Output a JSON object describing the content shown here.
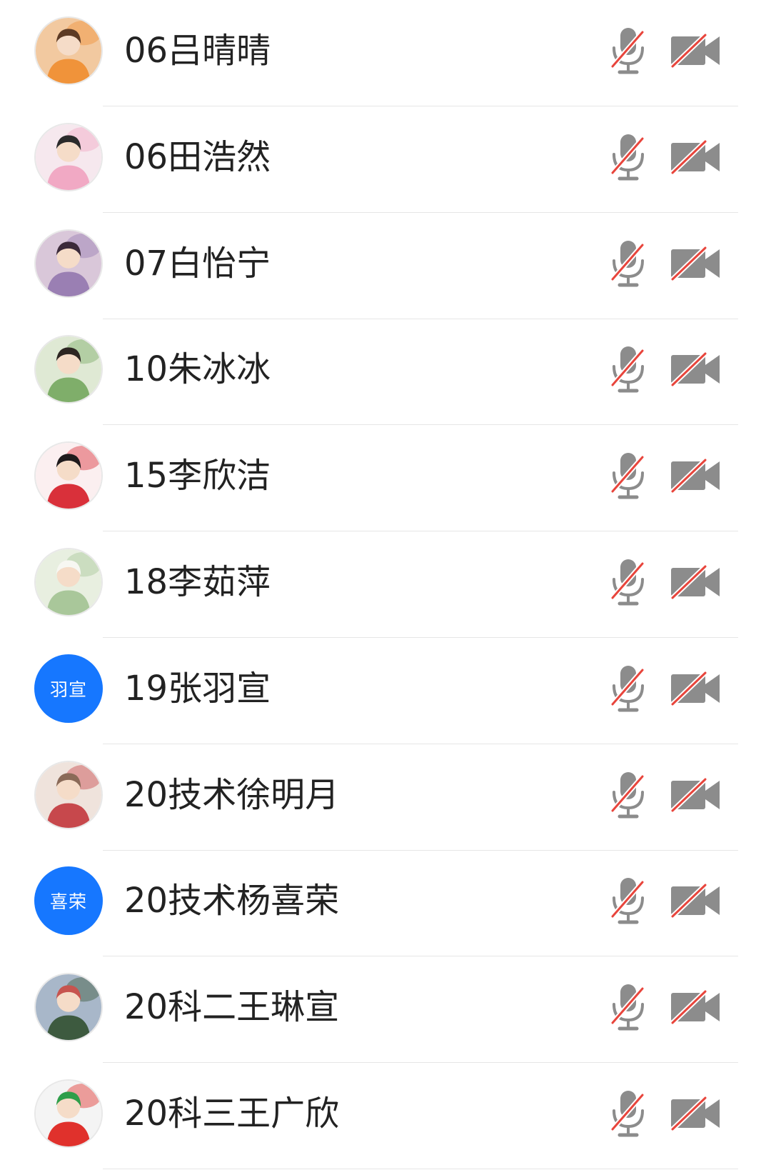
{
  "participants": [
    {
      "name": "06吕晴晴",
      "avatar": {
        "type": "photo",
        "icon": "user-photo",
        "palette": [
          "#f2c9a0",
          "#f0933a",
          "#5c3a24"
        ]
      }
    },
    {
      "name": "06田浩然",
      "avatar": {
        "type": "photo",
        "icon": "user-photo",
        "palette": [
          "#f6e8ee",
          "#f1a9c4",
          "#2b2b2b"
        ]
      }
    },
    {
      "name": "07白怡宁",
      "avatar": {
        "type": "photo",
        "icon": "user-photo",
        "palette": [
          "#d9c7d9",
          "#9a7fb3",
          "#3b2a3a"
        ]
      }
    },
    {
      "name": "10朱冰冰",
      "avatar": {
        "type": "photo",
        "icon": "user-photo",
        "palette": [
          "#dfe9d4",
          "#7fae6a",
          "#2d2622"
        ]
      }
    },
    {
      "name": "15李欣洁",
      "avatar": {
        "type": "photo",
        "icon": "user-photo",
        "palette": [
          "#fbeff0",
          "#d9303a",
          "#1e1a1c"
        ]
      }
    },
    {
      "name": "18李茹萍",
      "avatar": {
        "type": "photo",
        "icon": "user-photo",
        "palette": [
          "#e8efe0",
          "#a9c79a",
          "#f7f7f2"
        ]
      }
    },
    {
      "name": "19张羽宣",
      "avatar": {
        "type": "text",
        "text": "羽宣"
      }
    },
    {
      "name": "20技术徐明月",
      "avatar": {
        "type": "photo",
        "icon": "user-photo",
        "palette": [
          "#efe3dc",
          "#c7484c",
          "#8a6a58"
        ]
      }
    },
    {
      "name": "20技术杨喜荣",
      "avatar": {
        "type": "text",
        "text": "喜荣"
      }
    },
    {
      "name": "20科二王琳宣",
      "avatar": {
        "type": "photo",
        "icon": "user-photo",
        "palette": [
          "#a8b7c9",
          "#3d5a3f",
          "#c7544f"
        ]
      }
    },
    {
      "name": "20科三王广欣",
      "avatar": {
        "type": "photo",
        "icon": "user-photo",
        "palette": [
          "#f4f4f4",
          "#e0312c",
          "#2f9e4a"
        ]
      }
    }
  ],
  "icons": {
    "mic": "microphone-muted-icon",
    "camera": "camera-off-icon"
  },
  "colors": {
    "text": "#222222",
    "icon_gray": "#8c8c8c",
    "slash_red": "#e8453c",
    "text_avatar_bg": "#1677ff",
    "divider": "#e6e6e6"
  }
}
